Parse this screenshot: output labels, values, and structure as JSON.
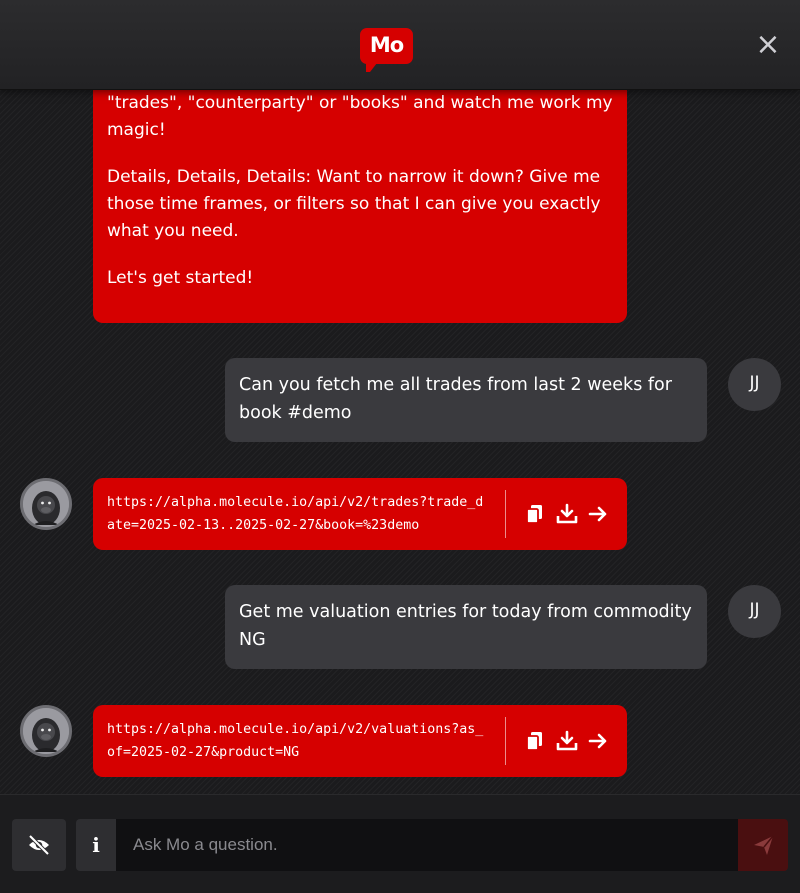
{
  "header": {
    "logo_text": "Mo",
    "close_label": "×"
  },
  "messages": {
    "intro_lines": [
      "\"trades\", \"counterparty\" or \"books\" and watch me work my magic!",
      "Details, Details, Details: Want to narrow it down? Give me those time frames, or filters so that I can give you exactly what you need.",
      "Let's get started!"
    ],
    "user_1": {
      "initials": "JJ",
      "text": "Can you fetch me all trades from last 2 weeks for book #demo"
    },
    "bot_1": {
      "url": "https://alpha.molecule.io/api/v2/trades?trade_date=2025-02-13..2025-02-27&book=%23demo"
    },
    "user_2": {
      "initials": "JJ",
      "text": "Get me valuation entries for today from commodity NG"
    },
    "bot_2": {
      "url": "https://alpha.molecule.io/api/v2/valuations?as_of=2025-02-27&product=NG"
    }
  },
  "footer": {
    "info_label": "i",
    "input_placeholder": "Ask Mo a question.",
    "input_value": ""
  },
  "icons": {
    "copy": "copy-icon",
    "download": "download-icon",
    "open": "arrow-right-icon",
    "hide": "eye-slash-icon",
    "send": "paper-plane-icon"
  },
  "colors": {
    "brand_red": "#d60000",
    "user_bubble": "#3a3a3e",
    "background": "#1b1b1d",
    "send_disabled": "#4a0f10"
  }
}
